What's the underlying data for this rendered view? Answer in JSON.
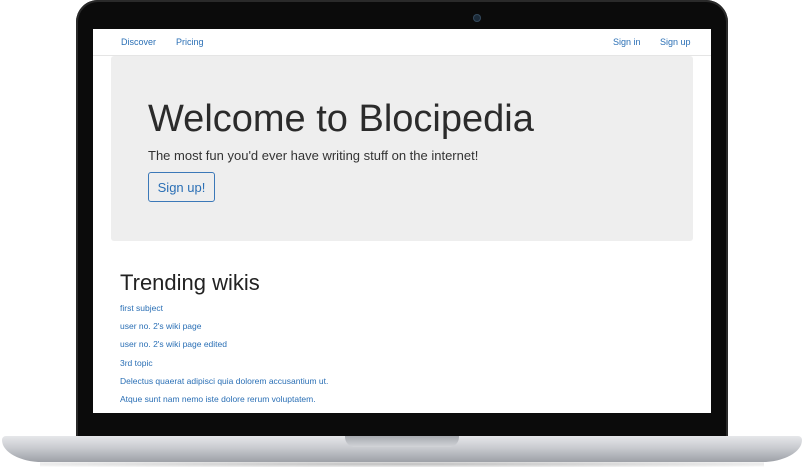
{
  "navbar": {
    "left_links": [
      "Discover",
      "Pricing"
    ],
    "right_links": [
      "Sign in",
      "Sign up"
    ]
  },
  "jumbotron": {
    "title": "Welcome to Blocipedia",
    "subtitle": "The most fun you'd ever have writing stuff on the internet!",
    "cta_label": "Sign up!"
  },
  "trending": {
    "heading": "Trending wikis",
    "items": [
      "first subject",
      "user no. 2's wiki page",
      "user no. 2's wiki page edited",
      "3rd topic",
      "Delectus quaerat adipisci quia dolorem accusantium ut.",
      "Atque sunt nam nemo iste dolore rerum voluptatem."
    ]
  },
  "colors": {
    "link": "#2a6fb5",
    "jumbotron_bg": "#eeeeee",
    "bezel": "#0b0b0b"
  }
}
